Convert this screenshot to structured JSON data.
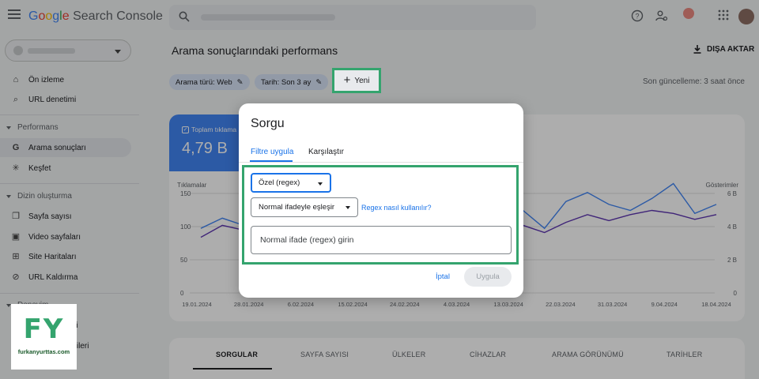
{
  "app": {
    "logo_google": [
      "G",
      "o",
      "o",
      "g",
      "l",
      "e"
    ],
    "logo_product": "Search Console"
  },
  "sidebar": {
    "items": [
      {
        "label": "Ön izleme",
        "icon": "home-icon"
      },
      {
        "label": "URL denetimi",
        "icon": "search-icon"
      },
      {
        "label": "Arama sonuçları",
        "icon": "google-g-icon",
        "active": true
      },
      {
        "label": "Keşfet",
        "icon": "asterisk-icon"
      },
      {
        "label": "Sayfa sayısı",
        "icon": "pages-icon"
      },
      {
        "label": "Video sayfaları",
        "icon": "video-pages-icon"
      },
      {
        "label": "Site Haritaları",
        "icon": "sitemap-icon"
      },
      {
        "label": "URL Kaldırma",
        "icon": "eye-off-icon"
      },
      {
        "label": "mi",
        "icon": "bolt-icon"
      },
      {
        "label": "erileri",
        "icon": "data-icon"
      }
    ],
    "sections": {
      "performance": "Performans",
      "index": "Dizin oluşturma",
      "experience": "Deneyim"
    }
  },
  "main": {
    "title": "Arama sonuçlarındaki performans",
    "export_label": "DIŞA AKTAR",
    "chips": [
      "Arama türü: Web",
      "Tarih: Son 3 ay"
    ],
    "new_label": "Yeni",
    "last_update": "Son güncelleme: 3 saat önce"
  },
  "metric": {
    "label": "Toplam tıklama",
    "value": "4,79 B"
  },
  "chart_data": {
    "type": "line",
    "ylabel_left": "Tıklamalar",
    "ylabel_right": "Gösterimler",
    "yticks_left": [
      "150",
      "100",
      "50",
      "0"
    ],
    "yticks_right": [
      "6 B",
      "4 B",
      "2 B",
      "0"
    ],
    "x": [
      "19.01.2024",
      "28.01.2024",
      "6.02.2024",
      "15.02.2024",
      "24.02.2024",
      "4.03.2024",
      "13.03.2024",
      "22.03.2024",
      "31.03.2024",
      "9.04.2024",
      "18.04.2024"
    ],
    "series": [
      {
        "color": "#4285f4",
        "values": [
          95,
          112,
          100,
          108,
          98,
          118,
          103,
          130,
          92,
          118,
          110,
          140,
          100,
          120,
          105,
          125,
          95,
          140,
          155,
          135,
          125,
          145,
          170,
          120,
          135
        ]
      },
      {
        "color": "#5e35b1",
        "values": [
          80,
          100,
          92,
          88,
          92,
          98,
          94,
          100,
          88,
          105,
          92,
          92,
          85,
          98,
          95,
          100,
          88,
          105,
          118,
          108,
          118,
          125,
          120,
          110,
          118
        ]
      }
    ]
  },
  "table_tabs": [
    "SORGULAR",
    "SAYFA SAYISI",
    "ÜLKELER",
    "CİHAZLAR",
    "ARAMA GÖRÜNÜMÜ",
    "TARİHLER"
  ],
  "dialog": {
    "title": "Sorgu",
    "tabs": [
      "Filtre uygula",
      "Karşılaştır"
    ],
    "type_select": "Özel (regex)",
    "match_select": "Normal ifadeyle eşleşir",
    "regex_help": "Regex nasıl kullanılır?",
    "input_placeholder": "Normal ifade (regex) girin",
    "cancel_label": "İptal",
    "apply_label": "Uygula"
  },
  "watermark": {
    "letters": "FY",
    "url": "furkanyurttas.com"
  }
}
